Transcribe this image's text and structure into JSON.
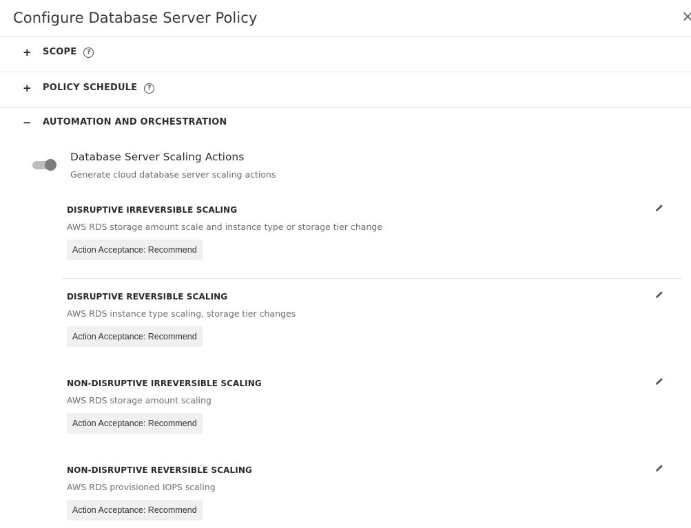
{
  "dialog": {
    "title": "Configure Database Server Policy",
    "close_symbol": "×"
  },
  "sections": [
    {
      "toggle_symbol": "+",
      "label": "SCOPE",
      "help": "?"
    },
    {
      "toggle_symbol": "+",
      "label": "POLICY SCHEDULE",
      "help": "?"
    },
    {
      "toggle_symbol": "−",
      "label": "AUTOMATION AND ORCHESTRATION"
    }
  ],
  "automation": {
    "toggle_title": "Database Server Scaling Actions",
    "toggle_subtitle": "Generate cloud database server scaling actions",
    "toggle_state": "on",
    "scalings": [
      {
        "name": "DISRUPTIVE IRREVERSIBLE SCALING",
        "description": "AWS RDS storage amount scale and instance type or storage tier change",
        "acceptance": "Action Acceptance: Recommend"
      },
      {
        "name": "DISRUPTIVE REVERSIBLE SCALING",
        "description": "AWS RDS instance type scaling, storage tier changes",
        "acceptance": "Action Acceptance: Recommend"
      },
      {
        "name": "NON-DISRUPTIVE IRREVERSIBLE SCALING",
        "description": "AWS RDS storage amount scaling",
        "acceptance": "Action Acceptance: Recommend"
      },
      {
        "name": "NON-DISRUPTIVE REVERSIBLE SCALING",
        "description": "AWS RDS provisioned IOPS scaling",
        "acceptance": "Action Acceptance: Recommend"
      }
    ]
  },
  "colors": {
    "toggle_track": "#bdbdbd",
    "toggle_knob": "#7d7d7d",
    "badge_bg": "#f0f0f0",
    "divider": "#e3e3e3"
  },
  "icons": {
    "close": "close-icon",
    "help": "help-circle-icon",
    "edit": "pencil-icon"
  }
}
